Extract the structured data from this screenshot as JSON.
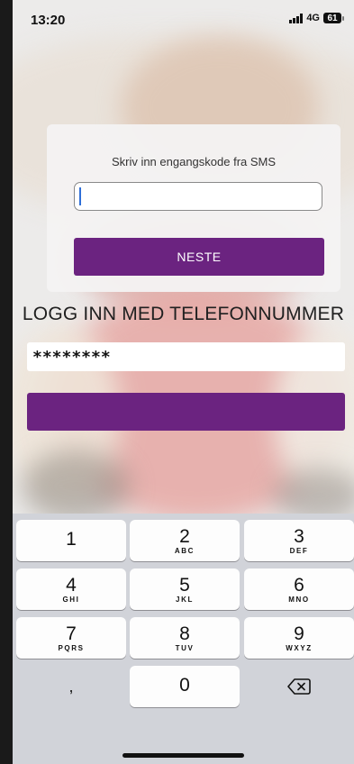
{
  "status_bar": {
    "time": "13:20",
    "network": "4G",
    "battery": "61"
  },
  "otp_card": {
    "title": "Skriv inn engangskode fra SMS",
    "code_value": "",
    "next_label": "NESTE"
  },
  "login": {
    "title": "LOGG INN MED TELEFONNUMMER",
    "phone_value": "********",
    "submit_label": ""
  },
  "keypad": {
    "keys": [
      {
        "digit": "1",
        "letters": ""
      },
      {
        "digit": "2",
        "letters": "ABC"
      },
      {
        "digit": "3",
        "letters": "DEF"
      },
      {
        "digit": "4",
        "letters": "GHI"
      },
      {
        "digit": "5",
        "letters": "JKL"
      },
      {
        "digit": "6",
        "letters": "MNO"
      },
      {
        "digit": "7",
        "letters": "PQRS"
      },
      {
        "digit": "8",
        "letters": "TUV"
      },
      {
        "digit": "9",
        "letters": "WXYZ"
      },
      {
        "digit": "0",
        "letters": ""
      }
    ],
    "comma_key": ",",
    "delete_icon": "backspace-icon"
  },
  "colors": {
    "accent": "#6b2380",
    "caret": "#2f6fd8",
    "keypad_bg": "#d1d3d9"
  }
}
